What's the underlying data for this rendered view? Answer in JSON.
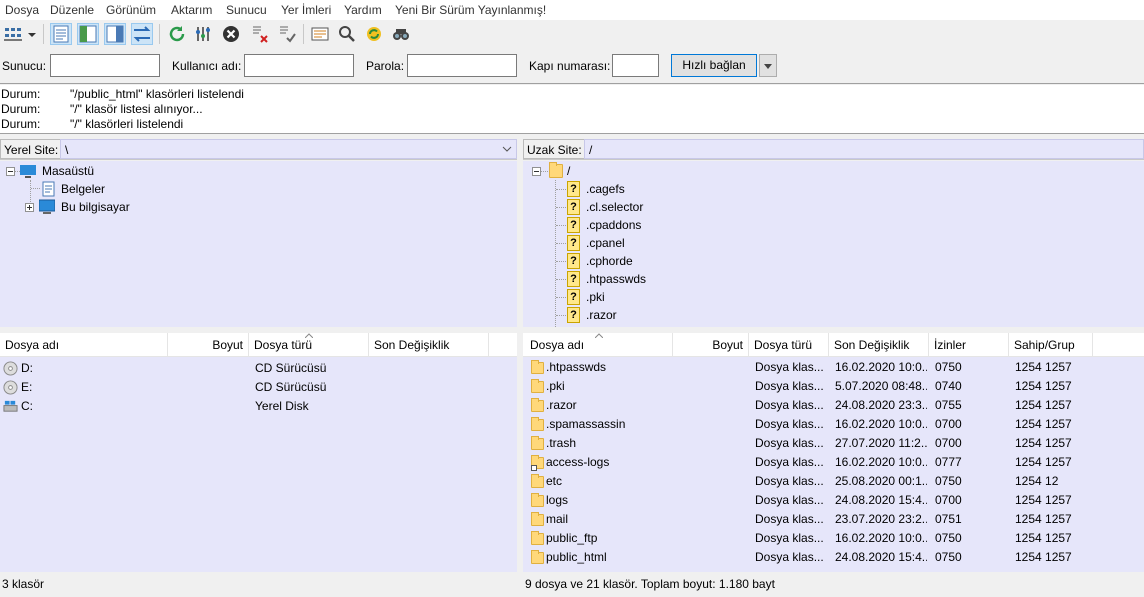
{
  "menu": [
    "Dosya",
    "Düzenle",
    "Görünüm",
    "Aktarım",
    "Sunucu",
    "Yer İmleri",
    "Yardım",
    "Yeni Bir Sürüm Yayınlanmış!"
  ],
  "toolbar": {
    "icons": [
      "site-manager-icon",
      "dropdown-arrow-icon",
      "toggle-log-icon",
      "toggle-local-tree-icon",
      "toggle-remote-tree-icon",
      "toggle-queue-icon",
      "refresh-icon",
      "process-queue-icon",
      "cancel-icon",
      "disconnect-icon",
      "reconnect-icon",
      "filter-icon",
      "compare-icon",
      "sync-browse-icon",
      "search-icon"
    ]
  },
  "quickconnect": {
    "host_label": "Sunucu:",
    "user_label": "Kullanıcı adı:",
    "pass_label": "Parola:",
    "port_label": "Kapı numarası:",
    "connect_button": "Hızlı bağlan",
    "host_value": "",
    "user_value": "",
    "pass_value": "",
    "port_value": ""
  },
  "log": [
    {
      "key": "Durum:",
      "value": "\"/public_html\" klasörleri listelendi"
    },
    {
      "key": "Durum:",
      "value": "\"/\" klasör listesi alınıyor..."
    },
    {
      "key": "Durum:",
      "value": "\"/\" klasörleri listelendi"
    }
  ],
  "local": {
    "site_label": "Yerel Site:",
    "site_path": "\\",
    "tree": [
      {
        "label": "Masaüstü",
        "icon": "desktop-icon"
      },
      {
        "label": "Belgeler",
        "icon": "documents-icon"
      },
      {
        "label": "Bu bilgisayar",
        "icon": "computer-icon"
      }
    ],
    "columns": [
      "Dosya adı",
      "Boyut",
      "Dosya türü",
      "Son Değişiklik"
    ],
    "rows": [
      {
        "name": "D:",
        "size": "",
        "type": "CD Sürücüsü",
        "modified": "",
        "icon": "cd-drive-icon"
      },
      {
        "name": "E:",
        "size": "",
        "type": "CD Sürücüsü",
        "modified": "",
        "icon": "cd-drive-icon"
      },
      {
        "name": "C:",
        "size": "",
        "type": "Yerel Disk",
        "modified": "",
        "icon": "local-disk-icon"
      }
    ],
    "status": "3 klasör"
  },
  "remote": {
    "site_label": "Uzak Site:",
    "site_path": "/",
    "tree_root": "/",
    "tree": [
      ".cagefs",
      ".cl.selector",
      ".cpaddons",
      ".cpanel",
      ".cphorde",
      ".htpasswds",
      ".pki",
      ".razor"
    ],
    "columns": [
      "Dosya adı",
      "Boyut",
      "Dosya türü",
      "Son Değişiklik",
      "İzinler",
      "Sahip/Grup"
    ],
    "rows": [
      {
        "name": ".htpasswds",
        "size": "",
        "type": "Dosya klas...",
        "modified": "16.02.2020 10:0...",
        "perms": "0750",
        "owner": "1254 1257",
        "icon": "folder-icon"
      },
      {
        "name": ".pki",
        "size": "",
        "type": "Dosya klas...",
        "modified": "5.07.2020 08:48...",
        "perms": "0740",
        "owner": "1254 1257",
        "icon": "folder-icon"
      },
      {
        "name": ".razor",
        "size": "",
        "type": "Dosya klas...",
        "modified": "24.08.2020 23:3...",
        "perms": "0755",
        "owner": "1254 1257",
        "icon": "folder-icon"
      },
      {
        "name": ".spamassassin",
        "size": "",
        "type": "Dosya klas...",
        "modified": "16.02.2020 10:0...",
        "perms": "0700",
        "owner": "1254 1257",
        "icon": "folder-icon"
      },
      {
        "name": ".trash",
        "size": "",
        "type": "Dosya klas...",
        "modified": "27.07.2020 11:2...",
        "perms": "0700",
        "owner": "1254 1257",
        "icon": "folder-icon"
      },
      {
        "name": "access-logs",
        "size": "",
        "type": "Dosya klas...",
        "modified": "16.02.2020 10:0...",
        "perms": "0777",
        "owner": "1254 1257",
        "icon": "folder-link-icon"
      },
      {
        "name": "etc",
        "size": "",
        "type": "Dosya klas...",
        "modified": "25.08.2020 00:1...",
        "perms": "0750",
        "owner": "1254 12",
        "icon": "folder-icon"
      },
      {
        "name": "logs",
        "size": "",
        "type": "Dosya klas...",
        "modified": "24.08.2020 15:4...",
        "perms": "0700",
        "owner": "1254 1257",
        "icon": "folder-icon"
      },
      {
        "name": "mail",
        "size": "",
        "type": "Dosya klas...",
        "modified": "23.07.2020 23:2...",
        "perms": "0751",
        "owner": "1254 1257",
        "icon": "folder-icon"
      },
      {
        "name": "public_ftp",
        "size": "",
        "type": "Dosya klas...",
        "modified": "16.02.2020 10:0...",
        "perms": "0750",
        "owner": "1254 1257",
        "icon": "folder-icon"
      },
      {
        "name": "public_html",
        "size": "",
        "type": "Dosya klas...",
        "modified": "24.08.2020 15:4...",
        "perms": "0750",
        "owner": "1254 1257",
        "icon": "folder-icon"
      }
    ],
    "status": "9 dosya ve 21 klasör. Toplam boyut: 1.180 bayt"
  }
}
